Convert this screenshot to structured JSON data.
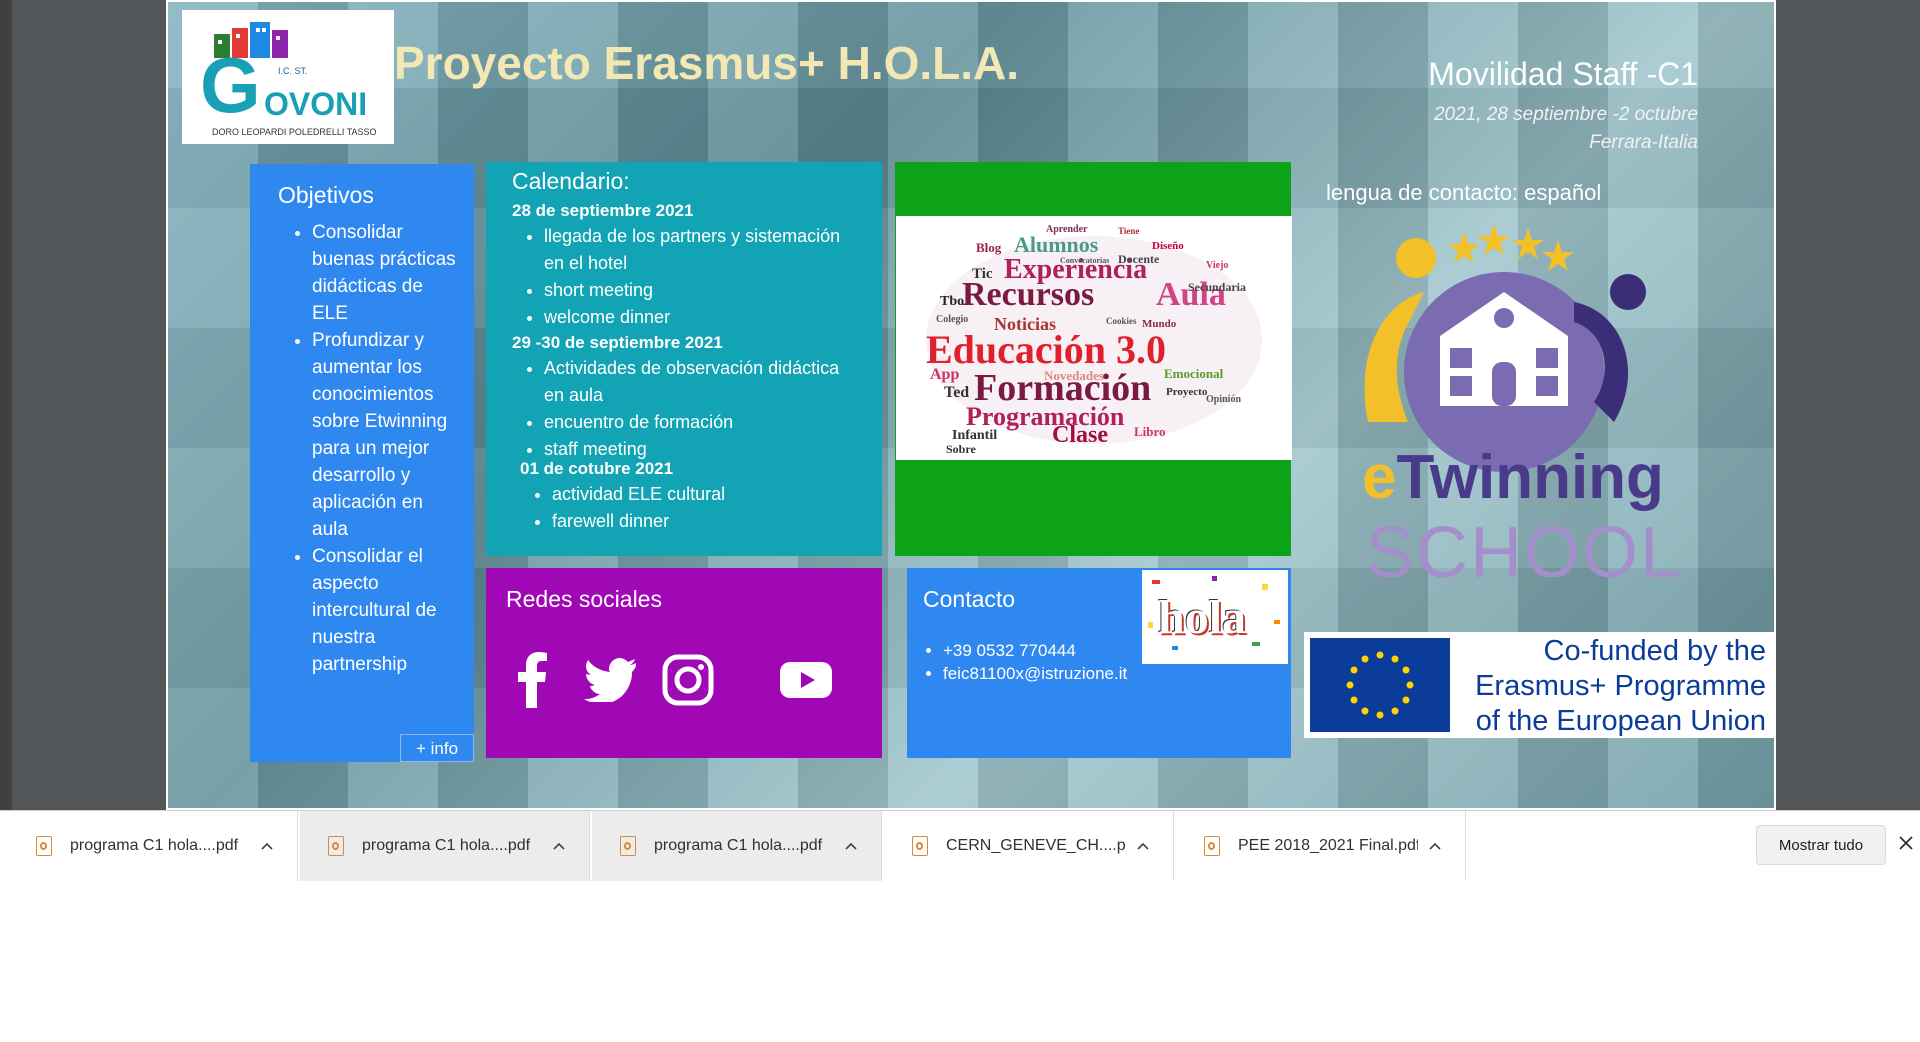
{
  "slide": {
    "logo": {
      "letter": "G",
      "name": "OVONI",
      "ic": "I.C. ST.",
      "subtitle": "DORO LEOPARDI POLEDRELLI TASSO"
    },
    "title": "Proyecto Erasmus+ H.O.L.A.",
    "movilidad": {
      "title": "Movilidad Staff -C1",
      "dates": "2021, 28 septiembre -2 octubre",
      "place": "Ferrara-Italia"
    },
    "lengua": "lengua de contacto: español",
    "objetivos": {
      "heading": "Objetivos",
      "items": [
        "Consolidar buenas prácticas didácticas de ELE",
        "Profundizar y aumentar los conocimientos sobre Etwinning para un mejor desarrollo y aplicación en aula",
        "Consolidar el aspecto intercultural de nuestra partnership"
      ],
      "more": "+ info"
    },
    "calendario": {
      "heading": "Calendario:",
      "days": [
        {
          "date": "28 de septiembre 2021",
          "items": [
            "llegada de los partners y sistemación en el hotel",
            "short meeting",
            "welcome dinner"
          ]
        },
        {
          "date": "29 -30 de septiembre 2021",
          "items": [
            "Actividades de observación didáctica en aula",
            "encuentro de formación",
            "staff meeting"
          ]
        },
        {
          "date": "01 de cotubre 2021",
          "items": [
            "actividad ELE cultural",
            "farewell dinner"
          ]
        }
      ]
    },
    "wordcloud": {
      "words": [
        "Aprender",
        "Tiene",
        "Blog",
        "Alumnos",
        "Diseño",
        "Tic",
        "Experiencia",
        "Docente",
        "Viejo",
        "Tbo",
        "Recursos",
        "Aula",
        "Colegio",
        "Noticias",
        "Mundo",
        "Educación 3.0",
        "App",
        "Novedades",
        "Emocional",
        "Ted",
        "Formación",
        "Proyecto",
        "Programación",
        "Infantil",
        "Clase",
        "Libro",
        "Sobre",
        "Secundaria",
        "Opinión",
        "Convocatorias",
        "Cookies"
      ]
    },
    "redes": {
      "heading": "Redes sociales"
    },
    "contacto": {
      "heading": "Contacto",
      "phone": "+39 0532 770444",
      "email": "feic81100x@istruzione.it"
    },
    "hola": "hola",
    "etwinning": {
      "e": "e",
      "twinning": "Twinning",
      "school": "SCHOOL"
    },
    "eu": {
      "line1": "Co-funded by the",
      "line2": "Erasmus+ Programme",
      "line3": "of the European Union"
    }
  },
  "downloads": {
    "items": [
      {
        "name": "programa C1 hola....pdf"
      },
      {
        "name": "programa C1 hola....pdf"
      },
      {
        "name": "programa C1 hola....pdf"
      },
      {
        "name": "CERN_GENEVE_CH....pdf"
      },
      {
        "name": "PEE 2018_2021 Final.pdf"
      }
    ],
    "show_all": "Mostrar tudo"
  },
  "colors": {
    "objetivos": "#2f88f0",
    "calendario": "#12a4b4",
    "green": "#0ca318",
    "redes": "#a008b6",
    "title": "#f3e7b4"
  }
}
